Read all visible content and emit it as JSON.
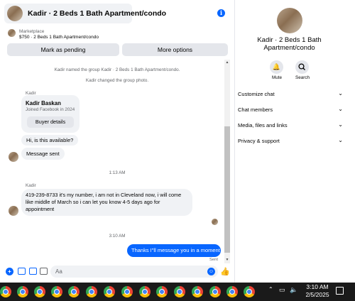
{
  "header": {
    "title": "Kadir · 2 Beds 1 Bath Apartment/condo"
  },
  "marketplace": {
    "label": "Marketplace",
    "listing": "$750 · 2 Beds 1 Bath Apartment/condo",
    "mark_pending_label": "Mark as pending",
    "more_options_label": "More options"
  },
  "messages": {
    "system1": "Kadir named the group Kadir · 2 Beds 1 Bath Apartment/condo.",
    "system2": "Kadir changed the group photo.",
    "sender1": "Kadir",
    "card_name": "Kadir Baskan",
    "card_joined": "Joined Facebook in 2024",
    "buyer_details_label": "Buyer details",
    "msg_available": "Hi, is this available?",
    "msg_sent": "Message sent",
    "timestamp1": "1:13 AM",
    "sender2": "Kadir",
    "msg_long": "419-239-8733 it's my number, i am not in Cleveland now, i will come like middle of March so i can let you know 4-5 days ago for appointment",
    "timestamp2": "3:10 AM",
    "outgoing": "Thanks I\"ll message you in a moment",
    "outgoing_status": "Sent"
  },
  "composer": {
    "placeholder": "Aa"
  },
  "panel": {
    "title": "Kadir · 2 Beds 1 Bath Apartment/condo",
    "mute_label": "Mute",
    "search_label": "Search",
    "items": [
      {
        "label": "Customize chat"
      },
      {
        "label": "Chat members"
      },
      {
        "label": "Media, files and links"
      },
      {
        "label": "Privacy & support"
      }
    ]
  },
  "taskbar": {
    "time": "3:10 AM",
    "date": "2/5/2025"
  },
  "colors": {
    "accent": "#0866ff",
    "bubble": "#f0f2f5",
    "taskbar": "#1a1a1a"
  },
  "icons": [
    "info-icon",
    "plus-icon",
    "image-icon",
    "sticker-icon",
    "gif-icon",
    "emoji-icon",
    "thumbs-up-icon",
    "mute-bell-icon",
    "search-icon",
    "chevron-down-icon",
    "chrome-icon",
    "notification-icon"
  ]
}
